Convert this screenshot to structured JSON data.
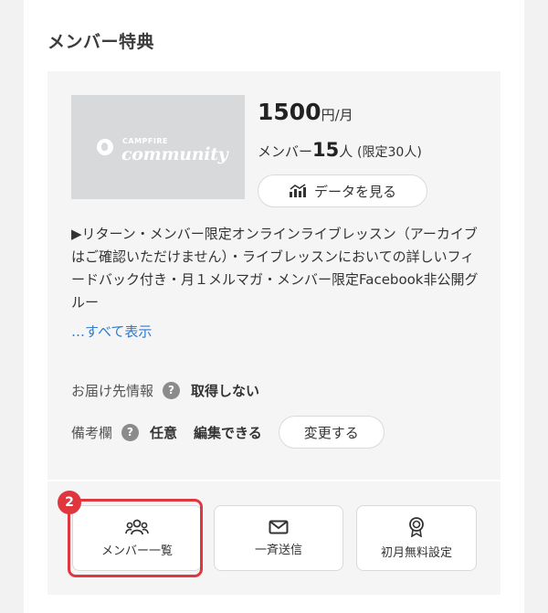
{
  "section": {
    "title": "メンバー特典"
  },
  "thumbnail": {
    "logo_top": "CAMPFIRE",
    "logo_main": "community"
  },
  "plan": {
    "price": "1500",
    "price_unit": "円/月",
    "members_prefix": "メンバー",
    "members_count": "15",
    "members_suffix": "人",
    "members_limit": "(限定30人)",
    "data_button": "データを見る"
  },
  "description": {
    "text": "▶リターン・メンバー限定オンラインライブレッスン（アーカイブはご確認いただけません）・ライブレッスンにおいての詳しいフィードバック付き・月１メルマガ・メンバー限定Facebook非公開グルー",
    "show_all": "…すべて表示"
  },
  "fields": {
    "delivery_label": "お届け先情報",
    "delivery_value": "取得しない",
    "notes_label": "備考欄",
    "notes_value1": "任意",
    "notes_value2": "編集できる",
    "change_button": "変更する",
    "help_glyph": "?"
  },
  "actions": {
    "member_list": "メンバー一覧",
    "broadcast": "一斉送信",
    "first_month_free": "初月無料設定",
    "badge": "2"
  },
  "colors": {
    "highlight": "#e0373f",
    "link": "#2b7bd0"
  },
  "icons": {
    "data": "chart-icon",
    "members": "people-icon",
    "broadcast": "mail-icon",
    "free": "award-icon"
  }
}
